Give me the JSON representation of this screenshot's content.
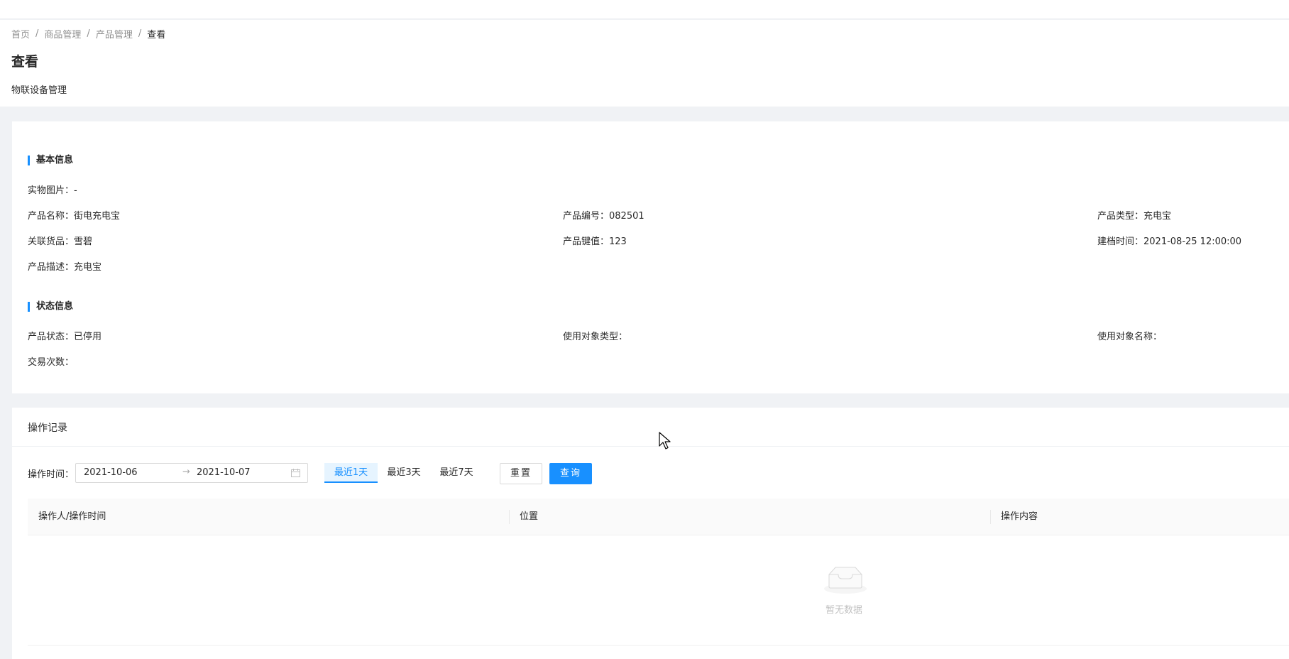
{
  "breadcrumb": [
    "首页",
    "商品管理",
    "产品管理",
    "查看"
  ],
  "page": {
    "title": "查看",
    "subtitle": "物联设备管理"
  },
  "basic_info": {
    "title": "基本信息",
    "photo": "实物图片：-",
    "product_name": "产品名称：街电充电宝",
    "product_code": "产品编号：082501",
    "product_type": "产品类型：充电宝",
    "related_goods": "关联货品：雪碧",
    "product_key": "产品键值：123",
    "created_time": "建档时间：2021-08-25 12:00:00",
    "description": "产品描述：充电宝"
  },
  "status_info": {
    "title": "状态信息",
    "status": "产品状态：已停用",
    "object_type": "使用对象类型：",
    "object_name": "使用对象名称：",
    "trade_count": "交易次数："
  },
  "log": {
    "title": "操作记录",
    "filter_label": "操作时间：",
    "date_start": "2021-10-06",
    "date_separator": "→",
    "date_end": "2021-10-07",
    "quick_1": "最近1天",
    "quick_3": "最近3天",
    "quick_7": "最近7天",
    "reset_label": "重置",
    "query_label": "查询",
    "columns": [
      "操作人/操作时间",
      "位置",
      "操作内容"
    ],
    "empty_text": "暂无数据"
  },
  "colors": {
    "primary": "#1890ff",
    "background": "#f0f2f5"
  },
  "icons": {
    "calendar": "calendar-icon",
    "empty": "empty-inbox-icon",
    "cursor": "mouse-pointer-icon"
  }
}
